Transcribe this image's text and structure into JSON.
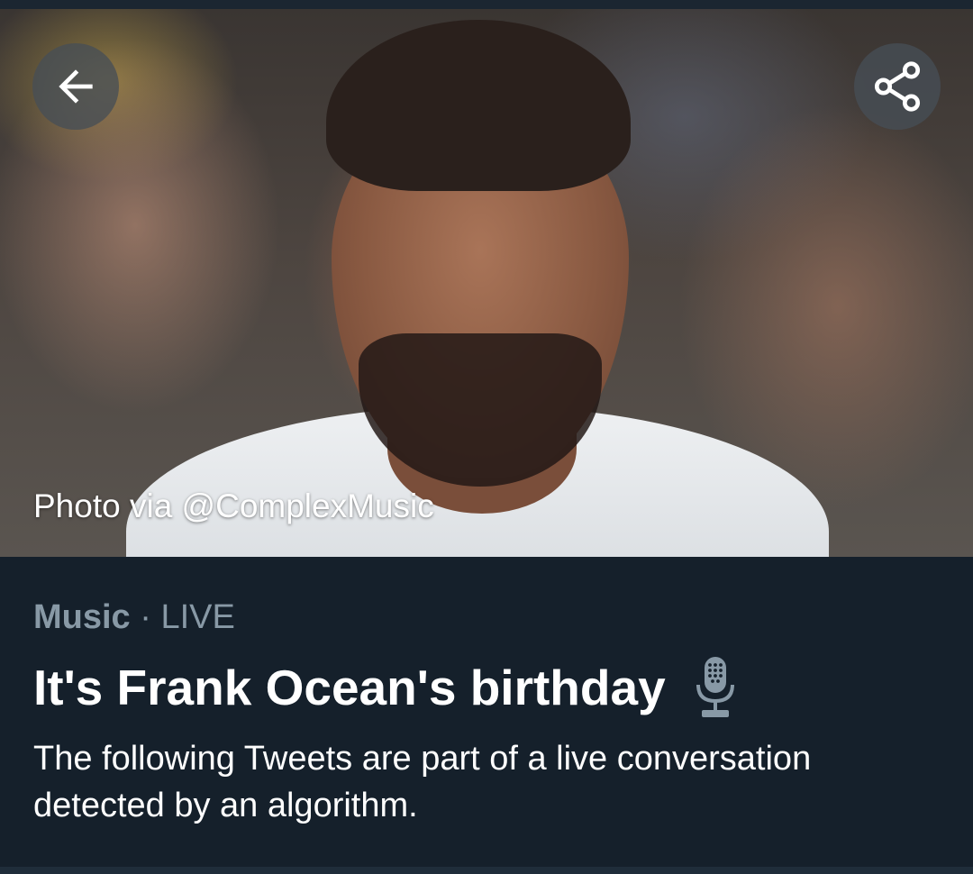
{
  "hero": {
    "photo_credit": "Photo via @ComplexMusic",
    "back_icon": "arrow-left-icon",
    "share_icon": "share-icon"
  },
  "topic": {
    "category": "Music",
    "separator": "·",
    "status": "LIVE",
    "title": "It's Frank Ocean's birthday",
    "title_icon": "microphone-icon",
    "description": "The following Tweets are part of a live conversation detected by an algorithm."
  },
  "colors": {
    "background": "#15202b",
    "muted_text": "#8899a6",
    "primary_text": "#ffffff",
    "button_overlay": "#464e56"
  }
}
